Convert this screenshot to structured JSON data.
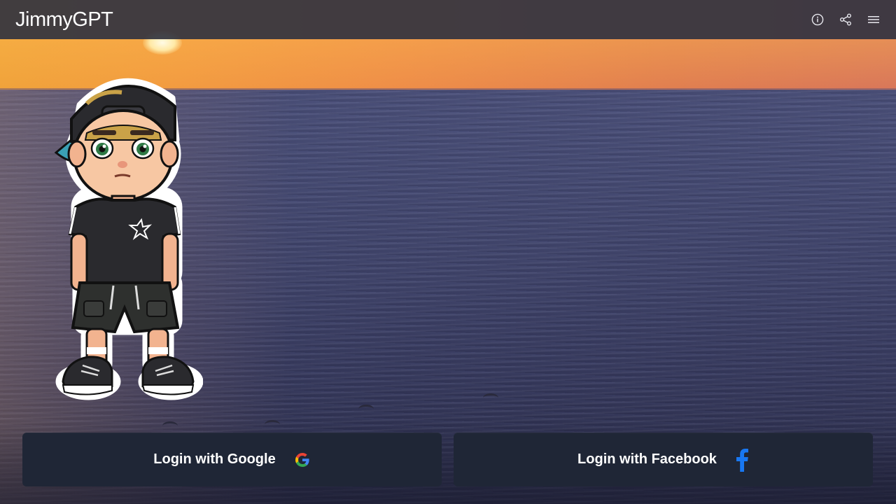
{
  "app": {
    "title": "JimmyGPT"
  },
  "header": {
    "icons": [
      "info-icon",
      "share-icon",
      "menu-icon"
    ]
  },
  "avatar": {
    "description": "cartoon boy character"
  },
  "login": {
    "google_label": "Login with Google",
    "facebook_label": "Login with Facebook",
    "google_icon": "google-icon",
    "facebook_icon": "facebook-icon"
  },
  "colors": {
    "header_bg": "#323440",
    "button_bg": "#1f2636",
    "facebook_blue": "#1877f2",
    "text": "#ffffff"
  }
}
